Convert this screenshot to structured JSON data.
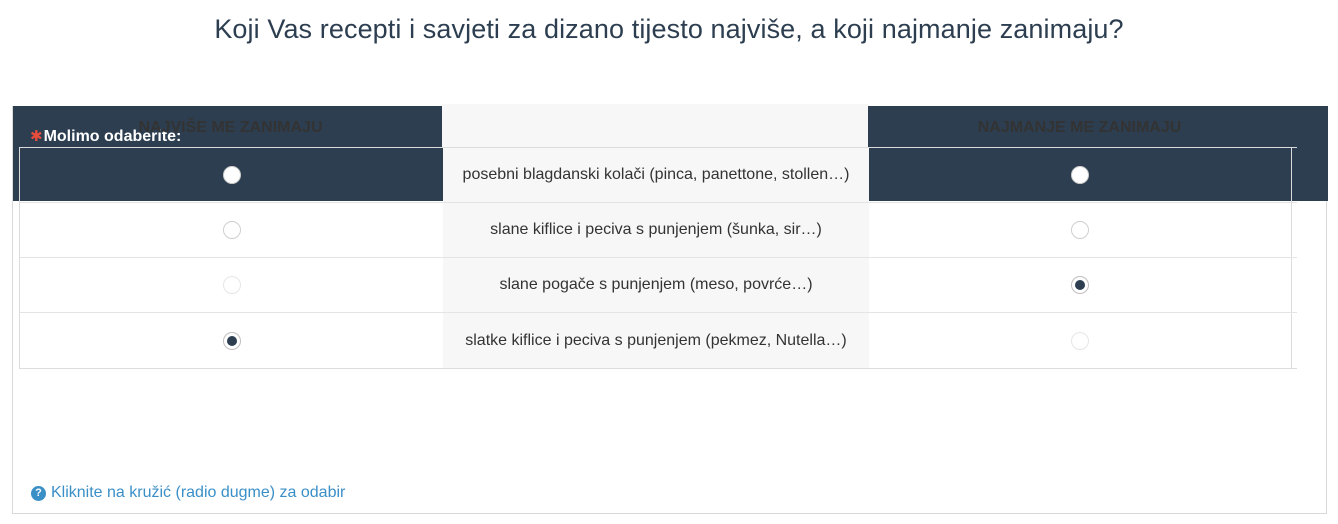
{
  "question": {
    "title": "Koji Vas recepti i savjeti za dizano tijesto najviše, a koji najmanje zanimaju?",
    "required_mark": "✱",
    "instruction": "Molimo odaberite:"
  },
  "matrix": {
    "col_most": "NAJVIŠE ME ZANIMAJU",
    "col_least": "NAJMANJE ME ZANIMAJU",
    "rows": [
      {
        "label": "posebni blagdanski kolači (pinca, panettone, stollen…)",
        "most": "unchecked",
        "least": "unchecked"
      },
      {
        "label": "slane kiflice i peciva s punjenjem (šunka, sir…)",
        "most": "unchecked",
        "least": "unchecked"
      },
      {
        "label": "slane pogače s punjenjem (meso, povrće…)",
        "most": "disabled",
        "least": "checked"
      },
      {
        "label": "slatke kiflice i peciva s punjenjem (pekmez, Nutella…)",
        "most": "checked",
        "least": "disabled"
      }
    ]
  },
  "hint": {
    "icon": "question-circle-icon",
    "glyph": "?",
    "text": "Kliknite na kružić (radio dugme) za odabir"
  },
  "colors": {
    "header_bg": "#2c3e50",
    "required": "#e74c3c",
    "hint": "#3a8fc7"
  }
}
